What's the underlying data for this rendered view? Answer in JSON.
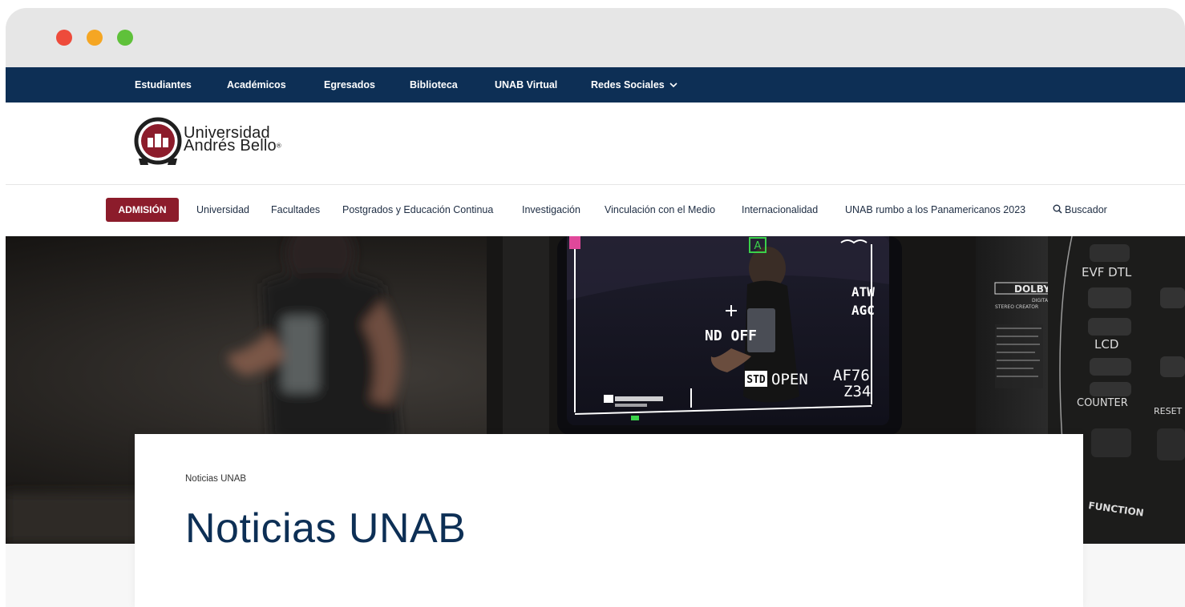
{
  "window": {
    "controls": {
      "close_color": "#ee4b3b",
      "minimize_color": "#f5a623",
      "maximize_color": "#5fc13a"
    }
  },
  "colors": {
    "top_bar": "#0d2f55",
    "admission": "#8c1c2b",
    "title": "#0d2f55"
  },
  "top_nav": {
    "items": [
      "Estudiantes",
      "Académicos",
      "Egresados",
      "Biblioteca",
      "UNAB Virtual"
    ],
    "social_label": "Redes Sociales",
    "social_icon": "chevron-down-icon"
  },
  "logo": {
    "line1": "Universidad",
    "line2": "Andrés Bello",
    "mark": "®"
  },
  "main_nav": {
    "admision": "ADMISIÓN",
    "items": [
      "Universidad",
      "Facultades",
      "Postgrados y Educación Continua",
      "Investigación",
      "Vinculación con el Medio",
      "Internacionalidad",
      "UNAB rumbo a los Panamericanos 2023"
    ],
    "search_label": "Buscador",
    "search_icon": "search-icon"
  },
  "hero": {
    "camera_labels": {
      "nd_off": "ND OFF",
      "atw": "ATW",
      "agc": "AGC",
      "std": "STD",
      "open": "OPEN",
      "af": "AF76",
      "zoom": "Z34",
      "badge": "A",
      "evf_dtl": "EVF DTL",
      "lcd": "LCD",
      "counter": "COUNTER",
      "reset": "RESET",
      "function": "FUNCTION",
      "dolby": "DOLBY",
      "dolby_sub1": "DIGITAL",
      "dolby_sub2": "STEREO CREATOR"
    }
  },
  "content": {
    "breadcrumb": "Noticias UNAB",
    "title": "Noticias UNAB"
  }
}
